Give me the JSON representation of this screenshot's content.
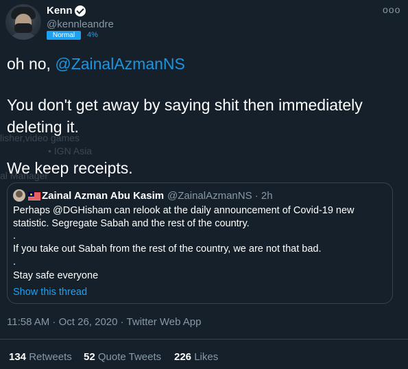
{
  "tweet": {
    "author_name": "Kenn",
    "author_handle": "@kennleandre",
    "badge_label": "Normal",
    "badge_percent": "4%",
    "more_glyph": "ooo",
    "text_prefix": "oh no, ",
    "mention": "@ZainalAzmanNS",
    "line2": "You don't get away by saying shit then immediately",
    "line3": "deleting it.",
    "line4": "We keep receipts.",
    "meta": "11:58 AM · Oct 26, 2020 · Twitter Web App"
  },
  "ghost_overlay": {
    "line1": "lisher,video games",
    "line2": "• IGN Asia",
    "line3": "al Manager"
  },
  "quote": {
    "author_name": "Zainal Azman Abu Kasim",
    "author_handle": "@ZainalAzmanNS · 2h",
    "lines": [
      "Perhaps @DGHisham can relook at the daily announcement of Covid-19 new",
      "statistic. Segregate Sabah and the rest of the country.",
      ".",
      "If you take out Sabah from the rest of the country, we are not that bad.",
      ".",
      "Stay safe everyone"
    ],
    "show_thread": "Show this thread"
  },
  "stats": {
    "retweets_count": "134",
    "retweets_label": "Retweets",
    "quotes_count": "52",
    "quotes_label": "Quote Tweets",
    "likes_count": "226",
    "likes_label": "Likes"
  },
  "colors": {
    "background": "#15202b",
    "accent": "#1da1f2",
    "secondary_text": "#8899a6",
    "border": "#38444d"
  }
}
